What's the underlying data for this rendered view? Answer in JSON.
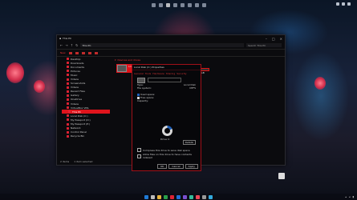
{
  "window": {
    "tab_title": "This PC",
    "address_path": "This PC",
    "search_placeholder": "Search This PC",
    "new_label": "New",
    "section_label": "Devices and drives"
  },
  "sidebar": {
    "items": [
      {
        "label": "Desktop"
      },
      {
        "label": "Downloads"
      },
      {
        "label": "Documents"
      },
      {
        "label": "Pictures"
      },
      {
        "label": "Music"
      },
      {
        "label": "Videos"
      },
      {
        "label": "Screenshots"
      },
      {
        "label": "Videos"
      },
      {
        "label": "Recent Files"
      },
      {
        "label": "Gallery"
      },
      {
        "label": "OneDrive"
      },
      {
        "label": "Videos"
      },
      {
        "label": "VirtualBox VMs"
      },
      {
        "label": "This PC",
        "selected": true
      },
      {
        "label": "Local Disk (C:)"
      },
      {
        "label": "My Passport (D:)"
      },
      {
        "label": "My Passport (E:)"
      },
      {
        "label": "Network"
      },
      {
        "label": "Control Panel"
      },
      {
        "label": "Recycle Bin"
      }
    ]
  },
  "drives": [
    {
      "name": "Local Disk (C:)",
      "free": "",
      "used_percent": 78
    },
    {
      "name": "My Passport (D:)",
      "free": "931 GB free of 931 GB",
      "used_percent": 8
    }
  ],
  "status": {
    "items": "2 items",
    "selected": "1 item selected"
  },
  "dialog": {
    "title": "Local Disk (C:) Properties",
    "tabs": [
      "General",
      "Tools",
      "Hardware",
      "Sharing",
      "Security"
    ],
    "type_label": "Type:",
    "type_value": "Local Disk",
    "fs_label": "File system:",
    "fs_value": "NTFS",
    "used_label": "Used space:",
    "used_value": "",
    "free_label": "Free space:",
    "free_value": "",
    "capacity_label": "Capacity:",
    "capacity_value": "",
    "drive_label": "Drive C:",
    "disk_cleanup": "Details",
    "compress_label": "Compress this drive to save disk space",
    "index_label": "Allow files on this drive to have contents indexed",
    "ok": "OK",
    "cancel": "Cancel",
    "apply": "Apply",
    "used_fraction": 0.19
  },
  "colors": {
    "accent": "#e0141c",
    "used_blue": "#1e5fb8",
    "free_gray": "#d8d8d8"
  }
}
